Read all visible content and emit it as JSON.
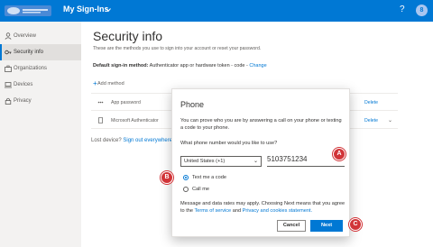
{
  "header": {
    "app_title": "My Sign-Ins",
    "help_label": "?",
    "avatar_initial": "8"
  },
  "sidebar": {
    "items": [
      {
        "label": "Overview"
      },
      {
        "label": "Security info"
      },
      {
        "label": "Organizations"
      },
      {
        "label": "Devices"
      },
      {
        "label": "Privacy"
      }
    ]
  },
  "main": {
    "title": "Security info",
    "subtitle": "These are the methods you use to sign into your account or reset your password.",
    "default_label": "Default sign-in method:",
    "default_value": "Authenticator app or hardware token - code",
    "change_label": "Change",
    "add_method_label": "Add method",
    "methods": [
      {
        "label": "App password",
        "delete": "Delete"
      },
      {
        "label": "Microsoft Authenticator",
        "delete": "Delete"
      }
    ],
    "lost_device_prefix": "Lost device?",
    "lost_device_link": "Sign out everywhere"
  },
  "dialog": {
    "title": "Phone",
    "description": "You can prove who you are by answering a call on your phone or texting a code to your phone.",
    "question": "What phone number would you like to use?",
    "country": "United States (+1)",
    "phone_number": "5103751234",
    "option_text": "Text me a code",
    "option_call": "Call me",
    "note_prefix": "Message and data rates may apply. Choosing Next means that you agree to the",
    "terms_link": "Terms of service",
    "note_and": "and",
    "privacy_link": "Privacy and cookies statement.",
    "cancel_label": "Cancel",
    "next_label": "Next"
  },
  "markers": {
    "a": "A",
    "b": "B",
    "c": "C"
  },
  "colors": {
    "accent": "#0078d4",
    "marker": "#d13438"
  }
}
